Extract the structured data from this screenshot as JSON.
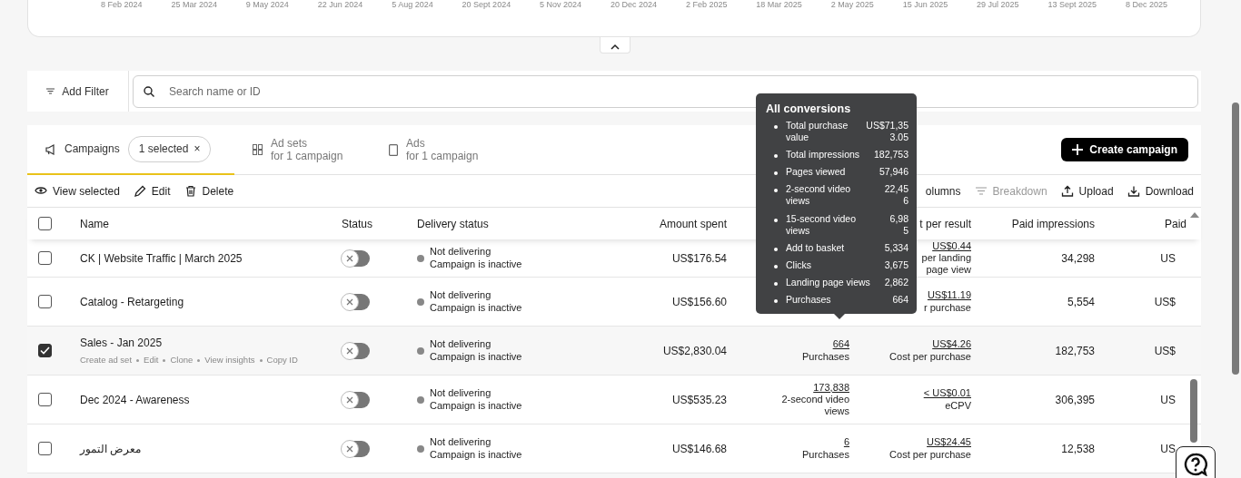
{
  "timeline_dates": [
    "8 Feb 2024",
    "25 Mar 2024",
    "9 May 2024",
    "22 Jun 2024",
    "5 Aug 2024",
    "20 Sept 2024",
    "5 Nov 2024",
    "20 Dec 2024",
    "2 Feb 2025",
    "18 Mar 2025",
    "2 May 2025",
    "15 Jun 2025",
    "29 Jul 2025",
    "13 Sept 2025",
    "8 Dec 2025"
  ],
  "filter": {
    "add_filter": "Add Filter",
    "search_placeholder": "Search name or ID"
  },
  "tabs": [
    {
      "kind": "campaigns",
      "label": "Campaigns",
      "selected": true,
      "chip": "1 selected",
      "chip_close": "×"
    },
    {
      "kind": "adsets",
      "label": "Ad sets",
      "sub": "for 1 campaign",
      "selected": false
    },
    {
      "kind": "ads",
      "label": "Ads",
      "sub": "for 1 campaign",
      "selected": false
    }
  ],
  "create_button": "Create campaign",
  "toolbar_left": [
    {
      "kind": "eye",
      "label": "View selected"
    },
    {
      "kind": "pencil",
      "label": "Edit"
    },
    {
      "kind": "trash",
      "label": "Delete"
    }
  ],
  "toolbar_right": [
    {
      "kind": "columns",
      "label": "olumns",
      "disabled": false
    },
    {
      "kind": "breakdown",
      "label": "Breakdown",
      "disabled": true
    },
    {
      "kind": "upload",
      "label": "Upload",
      "disabled": false
    },
    {
      "kind": "download",
      "label": "Download",
      "disabled": false
    }
  ],
  "table": {
    "columns": [
      "Name",
      "Status",
      "Delivery status",
      "Amount spent",
      "t per result",
      "Paid impressions",
      "Paid"
    ],
    "header_checked": false,
    "rows": [
      {
        "name": "CK | Website Traffic | March 2025",
        "selected": false,
        "on": false,
        "delivery": "Not delivering",
        "delivery_sub": "Campaign is inactive",
        "amount": "US$176.54",
        "cost": "US$0.44",
        "cost_label": "per landing page view",
        "impressions": "34,298",
        "paid": "US"
      },
      {
        "name": "Catalog - Retargeting",
        "selected": false,
        "on": false,
        "delivery": "Not delivering",
        "delivery_sub": "Campaign is inactive",
        "amount": "US$156.60",
        "cost": "US$11.19",
        "cost_label": "r purchase",
        "impressions": "5,554",
        "paid": "US$"
      },
      {
        "name": "Sales - Jan 2025",
        "selected": true,
        "actions": [
          "Create ad set",
          "Edit",
          "Clone",
          "View insights",
          "Copy ID"
        ],
        "on": false,
        "delivery": "Not delivering",
        "delivery_sub": "Campaign is inactive",
        "amount": "US$2,830.04",
        "result": "664",
        "result_label": "Purchases",
        "cost": "US$4.26",
        "cost_label": "Cost per purchase",
        "impressions": "182,753",
        "paid": "US$"
      },
      {
        "name": "Dec 2024 - Awareness",
        "selected": false,
        "on": false,
        "delivery": "Not delivering",
        "delivery_sub": "Campaign is inactive",
        "amount": "US$535.23",
        "result": "173,838",
        "result_label": "2-second video views",
        "cost": "< US$0.01",
        "cost_label": "eCPV",
        "impressions": "306,395",
        "paid": "US"
      },
      {
        "name": "معرض التمور",
        "selected": false,
        "on": false,
        "delivery": "Not delivering",
        "delivery_sub": "Campaign is inactive",
        "amount": "US$146.68",
        "result": "6",
        "result_label": "Purchases",
        "cost": "US$24.45",
        "cost_label": "Cost per purchase",
        "impressions": "12,538",
        "paid": "US"
      }
    ]
  },
  "tooltip": {
    "title": "All conversions",
    "items": [
      {
        "label": "Total purchase value",
        "value": "US$71,353.05"
      },
      {
        "label": "Total impressions",
        "value": "182,753"
      },
      {
        "label": "Pages viewed",
        "value": "57,946"
      },
      {
        "label": "2-second video views",
        "value": "22,456"
      },
      {
        "label": "15-second video views",
        "value": "6,985"
      },
      {
        "label": "Add to basket",
        "value": "5,334"
      },
      {
        "label": "Clicks",
        "value": "3,675"
      },
      {
        "label": "Landing page views",
        "value": "2,862"
      },
      {
        "label": "Purchases",
        "value": "664"
      }
    ]
  }
}
